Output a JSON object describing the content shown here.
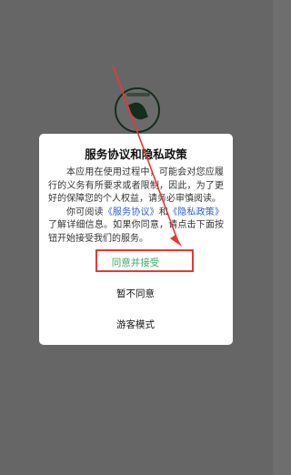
{
  "dialog": {
    "title": "服务协议和隐私政策",
    "para1": "本应用在使用过程中，可能会对您应履行的义务有所要求或者限制，因此，为了更好的保障您的个人权益，请务必审慎阅读。",
    "para2_prefix": "你可阅读",
    "service_link": "《服务协议》",
    "and_text": "和",
    "privacy_link": "《隐私政策》",
    "para2_suffix": "了解详细信息。如果你同意，请点击下面按钮开始接受我们的服务。",
    "agree_label": "同意并接受",
    "disagree_label": "暂不同意",
    "guest_label": "游客模式"
  },
  "colors": {
    "agree_text": "#3aa866",
    "link": "#2f62d1",
    "annotation": "#e53935"
  }
}
